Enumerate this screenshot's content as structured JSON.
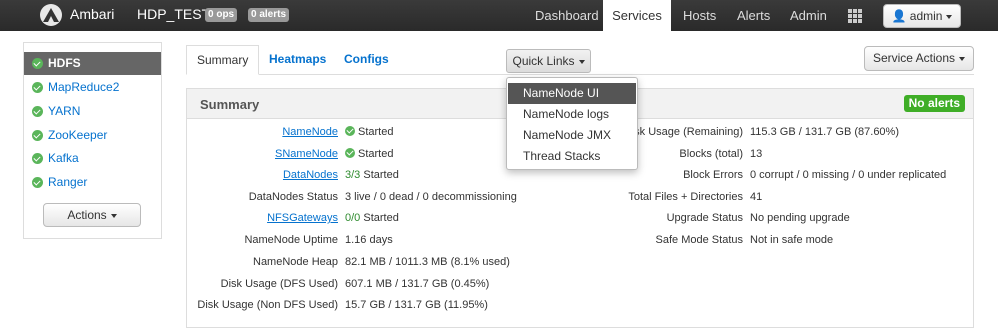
{
  "topbar": {
    "brand": "Ambari",
    "cluster": "HDP_TEST",
    "ops_badge": "0 ops",
    "alerts_badge": "0 alerts",
    "nav": [
      "Dashboard",
      "Services",
      "Hosts",
      "Alerts",
      "Admin"
    ],
    "user": "admin"
  },
  "sidebar": {
    "items": [
      "HDFS",
      "MapReduce2",
      "YARN",
      "ZooKeeper",
      "Kafka",
      "Ranger"
    ],
    "actions": "Actions"
  },
  "tabs": [
    "Summary",
    "Heatmaps",
    "Configs"
  ],
  "quick_links": {
    "label": "Quick Links",
    "items": [
      "NameNode UI",
      "NameNode logs",
      "NameNode JMX",
      "Thread Stacks"
    ]
  },
  "service_actions": "Service Actions",
  "summary": {
    "title": "Summary",
    "no_alerts": "No alerts",
    "left": [
      {
        "label": "NameNode",
        "value": "Started"
      },
      {
        "label": "SNameNode",
        "value": "Started"
      },
      {
        "label": "DataNodes",
        "value_green": "3/3",
        "value": "Started"
      },
      {
        "label": "DataNodes Status",
        "value": "3 live / 0 dead / 0 decommissioning"
      },
      {
        "label": "NFSGateways",
        "value_green": "0/0",
        "value": "Started"
      },
      {
        "label": "NameNode Uptime",
        "value": "1.16 days"
      },
      {
        "label": "NameNode Heap",
        "value": "82.1 MB / 1011.3 MB (8.1% used)"
      },
      {
        "label": "Disk Usage (DFS Used)",
        "value": "607.1 MB / 131.7 GB (0.45%)"
      },
      {
        "label": "Disk Usage (Non DFS Used)",
        "value": "15.7 GB / 131.7 GB (11.95%)"
      }
    ],
    "right": [
      {
        "label": "isk Usage (Remaining)",
        "value": "115.3 GB / 131.7 GB (87.60%)"
      },
      {
        "label": "Blocks (total)",
        "value": "13"
      },
      {
        "label": "Block Errors",
        "value": "0 corrupt / 0 missing / 0 under replicated"
      },
      {
        "label": "Total Files + Directories",
        "value": "41"
      },
      {
        "label": "Upgrade Status",
        "value": "No pending upgrade"
      },
      {
        "label": "Safe Mode Status",
        "value": "Not in safe mode"
      }
    ]
  }
}
